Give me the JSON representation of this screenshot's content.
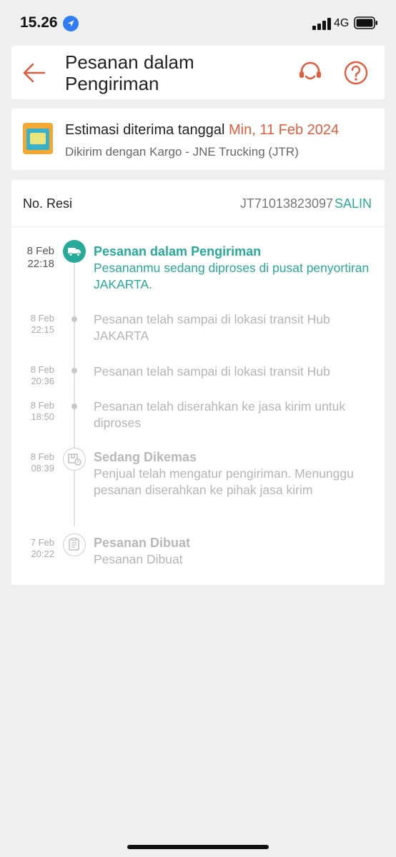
{
  "status_bar": {
    "time": "15.26",
    "network": "4G"
  },
  "header": {
    "title_line1": "Pesanan dalam",
    "title_line2": "Pengiriman"
  },
  "estimate": {
    "label": "Estimasi diterima tanggal",
    "date": "Min, 11 Feb 2024",
    "courier": "Dikirim dengan Kargo - JNE Trucking (JTR)"
  },
  "tracking": {
    "resi_label": "No. Resi",
    "resi_number": "JT71013823097",
    "copy_label": "SALIN",
    "events": [
      {
        "date": "8 Feb",
        "time": "22:18",
        "title": "Pesanan dalam Pengiriman",
        "description": "Pesananmu sedang diproses di pusat penyortiran JAKARTA.",
        "active": true,
        "icon": "truck-icon"
      },
      {
        "date": "8 Feb",
        "time": "22:15",
        "title": "",
        "description": "Pesanan telah sampai di lokasi transit Hub JAKARTA",
        "active": false,
        "icon": "dot"
      },
      {
        "date": "8 Feb",
        "time": "20:36",
        "title": "",
        "description": "Pesanan telah sampai di lokasi transit Hub",
        "active": false,
        "icon": "dot"
      },
      {
        "date": "8 Feb",
        "time": "18:50",
        "title": "",
        "description": "Pesanan telah diserahkan ke jasa kirim untuk diproses",
        "active": false,
        "icon": "dot"
      },
      {
        "date": "8 Feb",
        "time": "08:39",
        "title": "Sedang Dikemas",
        "description": "Penjual telah mengatur pengiriman. Menunggu pesanan diserahkan ke pihak jasa kirim",
        "active": false,
        "icon": "package-icon"
      },
      {
        "date": "7 Feb",
        "time": "20:22",
        "title": "Pesanan Dibuat",
        "description": "Pesanan Dibuat",
        "active": false,
        "icon": "clipboard-icon"
      }
    ]
  },
  "colors": {
    "accent": "#26aa99",
    "brand_orange": "#e85a3a",
    "background": "#efefef"
  }
}
